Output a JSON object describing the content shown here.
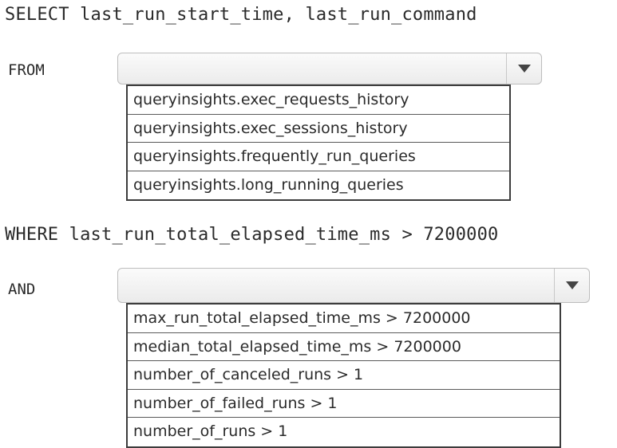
{
  "query": {
    "select_line": "SELECT last_run_start_time, last_run_command",
    "from_label": "FROM",
    "where_line": "WHERE last_run_total_elapsed_time_ms > 7200000",
    "and_label": "AND"
  },
  "from_dropdown": {
    "selected_value": "",
    "icon": "chevron-down-icon",
    "options": [
      "queryinsights.exec_requests_history",
      "queryinsights.exec_sessions_history",
      "queryinsights.frequently_run_queries",
      "queryinsights.long_running_queries"
    ]
  },
  "and_dropdown": {
    "selected_value": "",
    "icon": "chevron-down-icon",
    "options": [
      "max_run_total_elapsed_time_ms > 7200000",
      "median_total_elapsed_time_ms > 7200000",
      "number_of_canceled_runs > 1",
      "number_of_failed_runs > 1",
      "number_of_runs > 1"
    ]
  },
  "colors": {
    "text": "#2a2a2a",
    "border": "#3c3c3c",
    "arrow": "#444444"
  }
}
